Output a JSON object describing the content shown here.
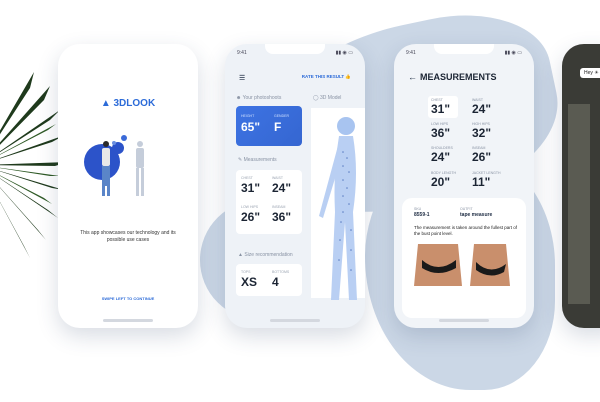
{
  "screen1": {
    "brand": "3DLOOK",
    "description": "This app showcases our technology and its possible use cases",
    "swipe_hint": "SWIPE LEFT TO CONTINUE"
  },
  "screen2": {
    "status_time": "9:41",
    "rate_button": "RATE THIS RESULT",
    "your_photoshoots": "Your photoshoots",
    "model_3d": "3D Model",
    "height_label": "HEIGHT",
    "height_value": "65\"",
    "gender_label": "GENDER",
    "gender_value": "F",
    "measurements_label": "Measurements",
    "measurements": [
      {
        "label": "CHEST",
        "value": "31\""
      },
      {
        "label": "WAIST",
        "value": "24\""
      },
      {
        "label": "LOW HIPS",
        "value": "26\""
      },
      {
        "label": "INSEAM",
        "value": "36\""
      }
    ],
    "size_rec_label": "Size recommendation",
    "sizes": [
      {
        "label": "TOPS",
        "value": "XS"
      },
      {
        "label": "BOTTOMS",
        "value": "4"
      }
    ]
  },
  "screen3": {
    "status_time": "9:41",
    "title": "MEASUREMENTS",
    "grid": [
      {
        "label": "CHEST",
        "value": "31\""
      },
      {
        "label": "WAIST",
        "value": "24\""
      },
      {
        "label": "LOW HIPS",
        "value": "36\""
      },
      {
        "label": "HIGH HIPS",
        "value": "32\""
      },
      {
        "label": "SHOULDERS",
        "value": "24\""
      },
      {
        "label": "INSEAM",
        "value": "26\""
      },
      {
        "label": "BODY LENGTH",
        "value": "20\""
      },
      {
        "label": "JACKET LENGTH",
        "value": "11\""
      }
    ],
    "sku_label": "SKU",
    "sku_value": "8559-1",
    "tool_label": "OUTFIT",
    "tool_value": "tape measure",
    "note": "The measurement is taken around the fullest part of the bust point level."
  },
  "screen4": {
    "badge": "Hey"
  }
}
